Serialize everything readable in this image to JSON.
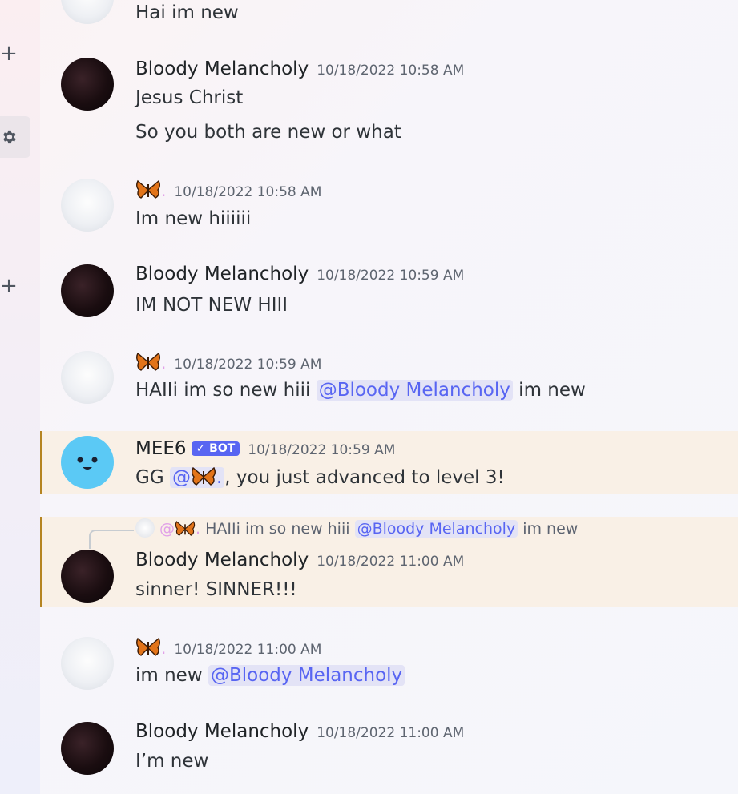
{
  "sidebar": {
    "add_icon": "plus-icon",
    "settings_icon": "gear-icon"
  },
  "messages": [
    {
      "text": "Hai im new"
    },
    {
      "author": "Bloody Melancholy",
      "timestamp": "10/18/2022 10:58 AM",
      "lines": [
        "Jesus Christ",
        "So you both are new or what"
      ]
    },
    {
      "author_dot": ".",
      "timestamp": "10/18/2022 10:58 AM",
      "text": "Im new hiiiiii"
    },
    {
      "author": "Bloody Melancholy",
      "timestamp": "10/18/2022 10:59 AM",
      "text": "IM NOT NEW HIII"
    },
    {
      "author_dot": ".",
      "timestamp": "10/18/2022 10:59 AM",
      "text_before": "HAIIi im so new hiii ",
      "mention": "@Bloody Melancholy",
      "text_after": " im new"
    },
    {
      "author": "MEE6",
      "bot_tag": "✓ BOT",
      "timestamp": "10/18/2022 10:59 AM",
      "text_before": "GG ",
      "mention_prefix": "@",
      "mention_suffix": ".",
      "text_after": ", you just advanced to level 3!"
    },
    {
      "reply": {
        "mention_prefix": "@",
        "dot": ".",
        "text_before": " HAIIi im so new hiii ",
        "mention": "@Bloody Melancholy",
        "text_after": " im new"
      },
      "author": "Bloody Melancholy",
      "timestamp": "10/18/2022 11:00 AM",
      "text": "sinner! SINNER!!!"
    },
    {
      "author_dot": ".",
      "timestamp": "10/18/2022 11:00 AM",
      "text_before": "im new ",
      "mention": "@Bloody Melancholy"
    },
    {
      "author": "Bloody Melancholy",
      "timestamp": "10/18/2022 11:00 AM",
      "text": "I’m new"
    }
  ]
}
